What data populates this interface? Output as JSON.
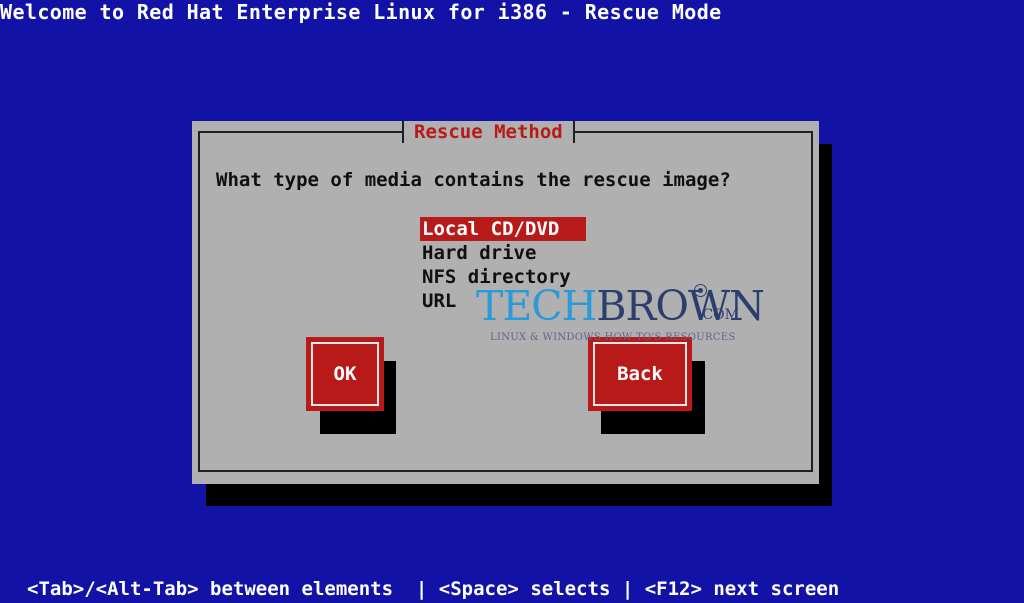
{
  "window": {
    "title": "Welcome to Red Hat Enterprise Linux for i386 - Rescue Mode"
  },
  "dialog": {
    "title": "Rescue Method",
    "question": "What type of media contains the rescue image?",
    "options": [
      {
        "label": "Local CD/DVD",
        "selected": true
      },
      {
        "label": "Hard drive",
        "selected": false
      },
      {
        "label": "NFS directory",
        "selected": false
      },
      {
        "label": "URL",
        "selected": false
      }
    ],
    "buttons": {
      "ok_label": "OK",
      "back_label": "Back"
    }
  },
  "watermark": {
    "brand_part1": "TECH",
    "brand_part2": "BROWN",
    "suffix": ".COM",
    "tagline": "LINUX & WINDOWS HOW TO'S RESOURCES"
  },
  "footer": {
    "help_text": "<Tab>/<Alt-Tab> between elements  | <Space> selects | <F12> next screen"
  },
  "colors": {
    "background": "#1212a6",
    "dialog": "#b0b0b0",
    "accent": "#b81a1a",
    "shadow": "#000000"
  }
}
